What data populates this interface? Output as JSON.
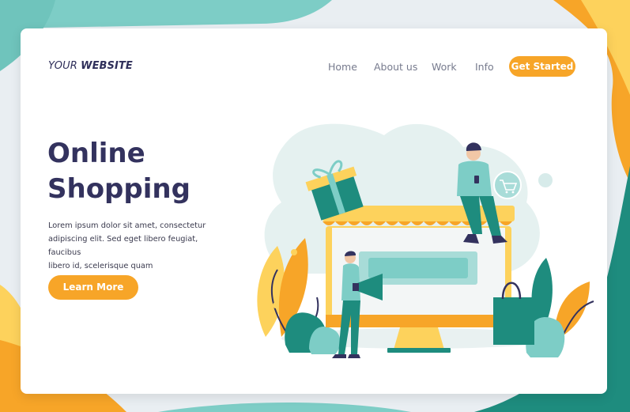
{
  "header": {
    "logo_regular": "YOUR ",
    "logo_bold": "WEBSITE",
    "nav": [
      {
        "label": "Home"
      },
      {
        "label": "About us"
      },
      {
        "label": "Work"
      },
      {
        "label": "Info"
      }
    ],
    "cta_label": "Get Started"
  },
  "hero": {
    "title_line1": "Online",
    "title_line2": "Shopping",
    "body_line1": "Lorem ipsum dolor sit amet, consectetur",
    "body_line2": "adipiscing elit. Sed eget libero feugiat, faucibus",
    "body_line3": "libero id, scelerisque quam",
    "button_label": "Learn More"
  },
  "colors": {
    "accent": "#f7a528",
    "teal": "#1e8c7e",
    "teal_light": "#7dcdc6",
    "navy": "#33325e",
    "yellow": "#fdd25c"
  },
  "illustration": {
    "icons": [
      "shopping-cart-icon",
      "gift-box-icon",
      "megaphone-icon",
      "shopping-bag-icon"
    ]
  }
}
